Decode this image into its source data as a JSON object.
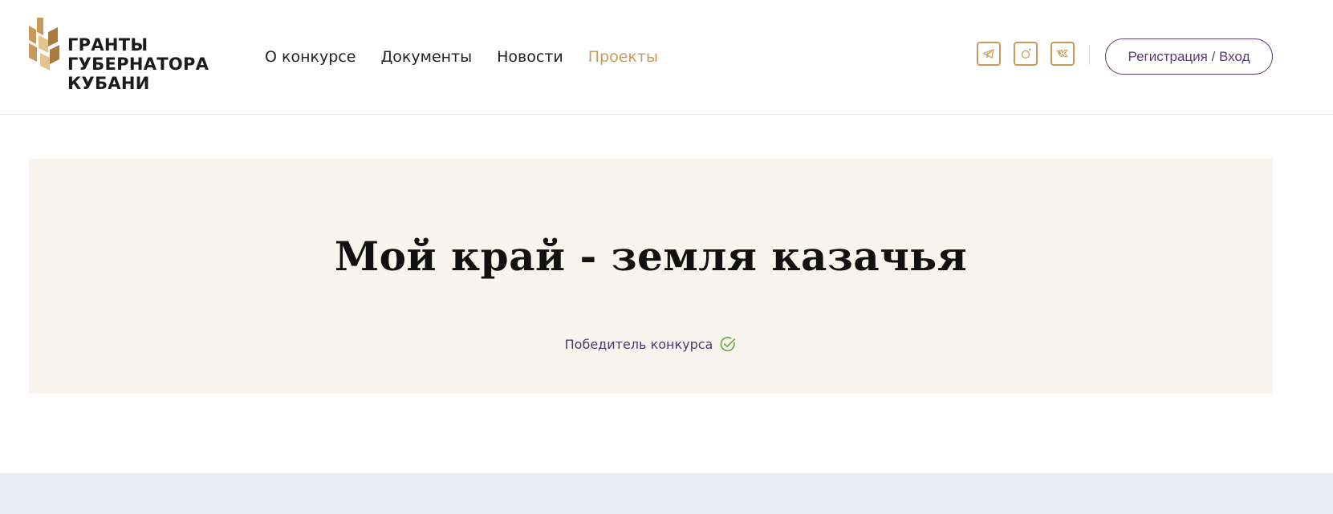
{
  "logo": {
    "line1": "ГРАНТЫ",
    "line2": "ГУБЕРНАТОРА",
    "line3": "КУБАНИ",
    "colors": [
      "#c9995a",
      "#e3c38f",
      "#a77c3e"
    ]
  },
  "nav": {
    "items": [
      {
        "label": "О конкурсе",
        "active": false
      },
      {
        "label": "Документы",
        "active": false
      },
      {
        "label": "Новости",
        "active": false
      },
      {
        "label": "Проекты",
        "active": true
      }
    ]
  },
  "socials": [
    {
      "icon": "telegram-icon"
    },
    {
      "icon": "instagram-icon"
    },
    {
      "icon": "vk-icon"
    }
  ],
  "header": {
    "login_label": "Регистрация / Вход"
  },
  "project": {
    "title": "Мой край - земля казачья",
    "status": "Победитель конкурса",
    "status_icon": "check-circle-icon"
  },
  "colors": {
    "accent": "#c9995a",
    "brand_purple": "#5c3b7e",
    "hero_bg": "#f8f5ee",
    "check_green": "#6aa843",
    "band_bg": "#e9edf5"
  }
}
